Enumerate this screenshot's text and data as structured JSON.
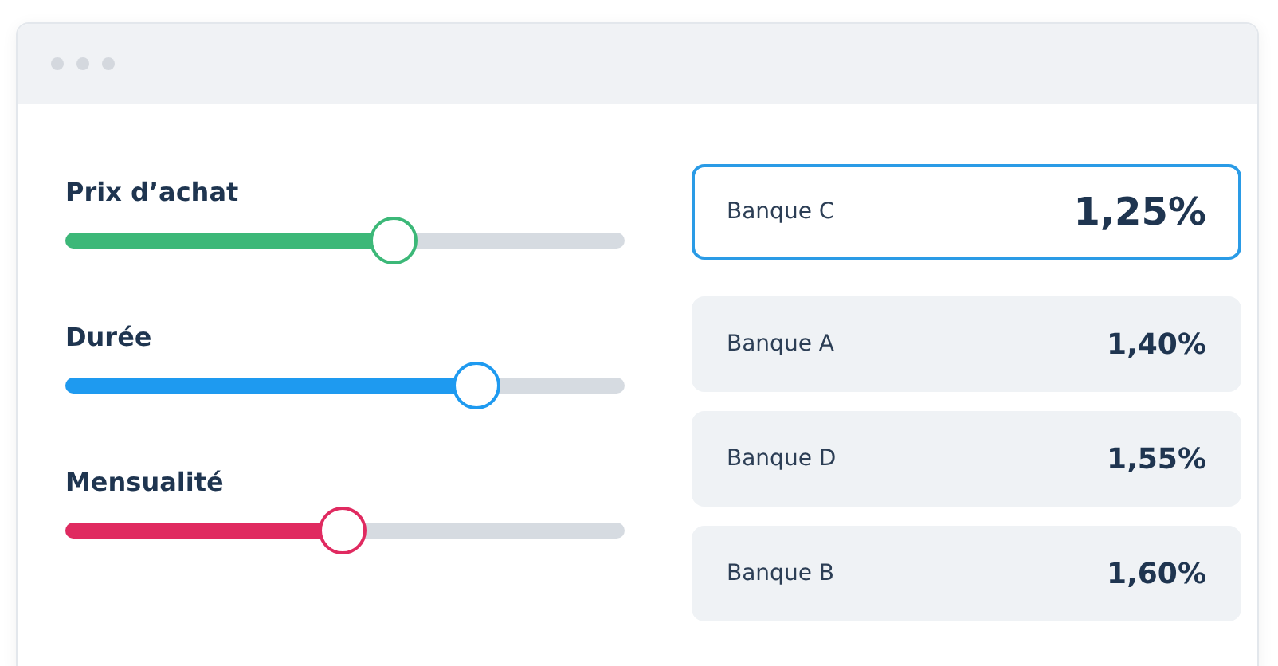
{
  "sliders": [
    {
      "label": "Prix d’achat",
      "level": 0.586,
      "color": "#3cb878"
    },
    {
      "label": "Durée",
      "level": 0.734,
      "color": "#1e9af0"
    },
    {
      "label": "Mensualité",
      "level": 0.497,
      "color": "#e02a60"
    }
  ],
  "offers": [
    {
      "bank": "Banque C",
      "rate": "1,25%",
      "selected": true
    },
    {
      "bank": "Banque A",
      "rate": "1,40%",
      "selected": false
    },
    {
      "bank": "Banque D",
      "rate": "1,55%",
      "selected": false
    },
    {
      "bank": "Banque B",
      "rate": "1,60%",
      "selected": false
    }
  ]
}
